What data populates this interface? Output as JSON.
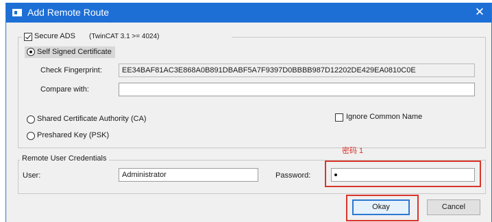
{
  "window": {
    "title": "Add Remote Route",
    "close_glyph": "✕",
    "title_icon": "window-app-icon"
  },
  "secure_ads": {
    "label": "Secure ADS",
    "version_note": "(TwinCAT 3.1 >= 4024)",
    "checked": true
  },
  "self_signed": {
    "label": "Self Signed Certificate",
    "selected": true,
    "fingerprint_label": "Check Fingerprint:",
    "fingerprint_value": "EE34BAF81AC3E868A0B891DBABF5A7F9397D0BBBB987D12202DE429EA0810C0E",
    "compare_label": "Compare with:",
    "compare_value": ""
  },
  "shared_ca": {
    "label": "Shared Certificate Authority (CA)",
    "selected": false
  },
  "ignore_cn": {
    "label": "Ignore Common Name",
    "checked": false
  },
  "psk": {
    "label": "Preshared Key (PSK)",
    "selected": false
  },
  "credentials": {
    "legend": "Remote User Credentials",
    "user_label": "User:",
    "user_value": "Administrator",
    "password_label": "Password:",
    "annotation": "密码 1"
  },
  "buttons": {
    "okay": "Okay",
    "cancel": "Cancel"
  },
  "colors": {
    "titlebar": "#1d6fd6",
    "annotation_red": "#d9352a",
    "dialog_bg": "#f0f0f0"
  }
}
